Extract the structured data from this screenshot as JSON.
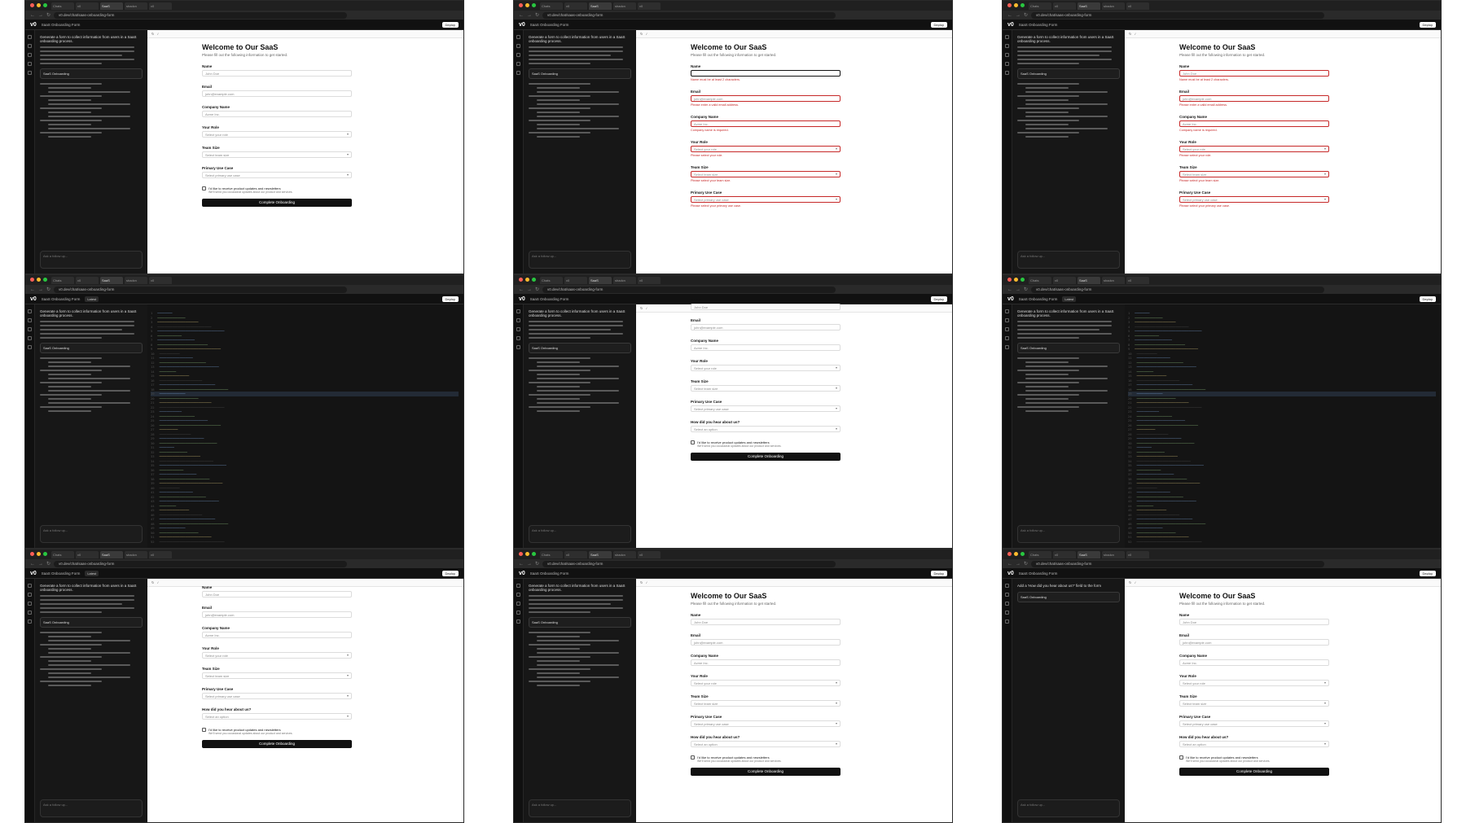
{
  "window": {
    "url": "v0.dev/chat/saas-onboarding-form",
    "tab_active": "SaaS Onboarding",
    "tabs": [
      "Chats",
      "v0",
      "SaaS",
      "shadcn",
      "v0"
    ]
  },
  "app": {
    "logo": "v0",
    "project": "SaaS Onboarding Form",
    "badge": "Latest",
    "deploy_label": "Deploy"
  },
  "subtabs": {
    "preview": "Preview",
    "code": "Code",
    "console": "Console"
  },
  "chat": {
    "first_message": "Generate a form to collect information from users in a SaaS onboarding process.",
    "card_title": "SaaS Onboarding",
    "input_placeholder": "Ask a follow up...",
    "latest_message": "Add a 'How did you hear about us?' field to the form"
  },
  "form": {
    "title": "Welcome to Our SaaS",
    "subtitle": "Please fill out the following information to get started.",
    "fields": {
      "name": {
        "label": "Name",
        "placeholder": "John Doe",
        "error": "Name must be at least 2 characters."
      },
      "email": {
        "label": "Email",
        "placeholder": "john@example.com",
        "error": "Please enter a valid email address."
      },
      "company": {
        "label": "Company Name",
        "placeholder": "Acme Inc.",
        "error": "Company name is required."
      },
      "role": {
        "label": "Your Role",
        "placeholder": "Select your role",
        "error": "Please select your role."
      },
      "team": {
        "label": "Team Size",
        "placeholder": "Select team size",
        "error": "Please select your team size."
      },
      "usecase": {
        "label": "Primary Use Case",
        "placeholder": "Select primary use case",
        "error": "Please select your primary use case."
      },
      "heard": {
        "label": "How did you hear about us?",
        "placeholder": "Select an option"
      }
    },
    "updates_label": "I'd like to receive product updates and newsletters",
    "updates_sub": "We'll send you occasional updates about our product and services.",
    "submit_label": "Complete Onboarding"
  }
}
